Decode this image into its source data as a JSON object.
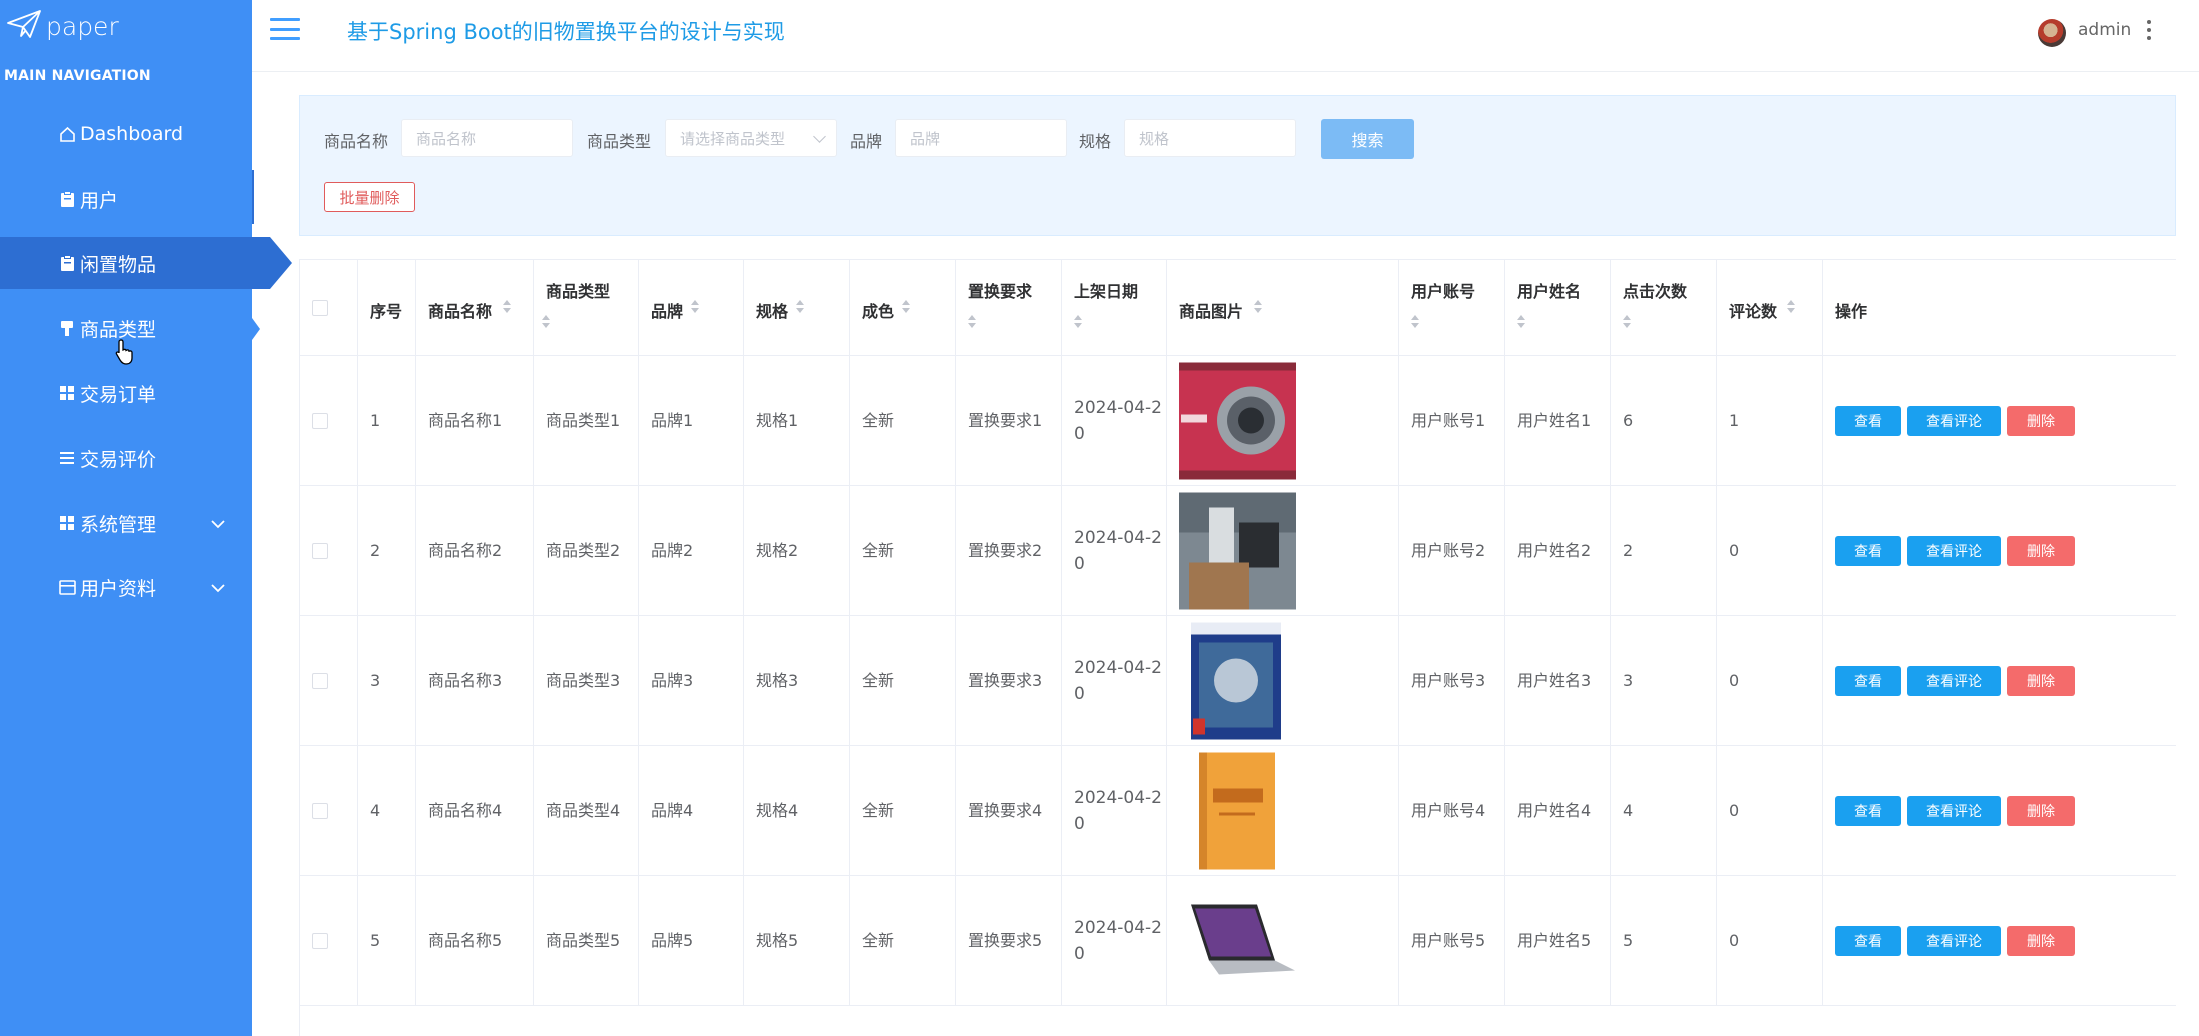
{
  "sidebar": {
    "logo": "paper",
    "nav_header": "MAIN NAVIGATION",
    "items": [
      {
        "label": "Dashboard",
        "icon": "home-icon"
      },
      {
        "label": "用户",
        "icon": "clipboard-icon"
      },
      {
        "label": "闲置物品",
        "icon": "clipboard-icon"
      },
      {
        "label": "商品类型",
        "icon": "brush-icon"
      },
      {
        "label": "交易订单",
        "icon": "grid-icon"
      },
      {
        "label": "交易评价",
        "icon": "list-icon"
      },
      {
        "label": "系统管理",
        "icon": "grid-icon"
      },
      {
        "label": "用户资料",
        "icon": "card-icon"
      }
    ]
  },
  "header": {
    "title": "基于Spring Boot的旧物置换平台的设计与实现",
    "user": "admin"
  },
  "search": {
    "name_label": "商品名称",
    "name_placeholder": "商品名称",
    "type_label": "商品类型",
    "type_placeholder": "请选择商品类型",
    "brand_label": "品牌",
    "brand_placeholder": "品牌",
    "spec_label": "规格",
    "spec_placeholder": "规格",
    "search_button": "搜索",
    "batch_delete": "批量删除"
  },
  "table": {
    "columns": [
      "序号",
      "商品名称",
      "商品类型",
      "品牌",
      "规格",
      "成色",
      "置换要求",
      "上架日期",
      "商品图片",
      "用户账号",
      "用户姓名",
      "点击次数",
      "评论数",
      "操作"
    ],
    "action_labels": {
      "view": "查看",
      "comment": "查看评论",
      "delete": "删除"
    },
    "rows": [
      {
        "index": "1",
        "name": "商品名称1",
        "type": "商品类型1",
        "brand": "品牌1",
        "spec": "规格1",
        "condition": "全新",
        "requirement": "置换要求1",
        "date": "2024-04-2\n0",
        "account": "用户账号1",
        "username": "用户姓名1",
        "clicks": "6",
        "comments": "1",
        "image": "camera"
      },
      {
        "index": "2",
        "name": "商品名称2",
        "type": "商品类型2",
        "brand": "品牌2",
        "spec": "规格2",
        "condition": "全新",
        "requirement": "置换要求2",
        "date": "2024-04-2\n0",
        "account": "用户账号2",
        "username": "用户姓名2",
        "clicks": "2",
        "comments": "0",
        "image": "room"
      },
      {
        "index": "3",
        "name": "商品名称3",
        "type": "商品类型3",
        "brand": "品牌3",
        "spec": "规格3",
        "condition": "全新",
        "requirement": "置换要求3",
        "date": "2024-04-2\n0",
        "account": "用户账号3",
        "username": "用户姓名3",
        "clicks": "3",
        "comments": "0",
        "image": "game"
      },
      {
        "index": "4",
        "name": "商品名称4",
        "type": "商品类型4",
        "brand": "品牌4",
        "spec": "规格4",
        "condition": "全新",
        "requirement": "置换要求4",
        "date": "2024-04-2\n0",
        "account": "用户账号4",
        "username": "用户姓名4",
        "clicks": "4",
        "comments": "0",
        "image": "book"
      },
      {
        "index": "5",
        "name": "商品名称5",
        "type": "商品类型5",
        "brand": "品牌5",
        "spec": "规格5",
        "condition": "全新",
        "requirement": "置换要求5",
        "date": "2024-04-2\n0",
        "account": "用户账号5",
        "username": "用户姓名5",
        "clicks": "5",
        "comments": "0",
        "image": "laptop"
      }
    ]
  }
}
